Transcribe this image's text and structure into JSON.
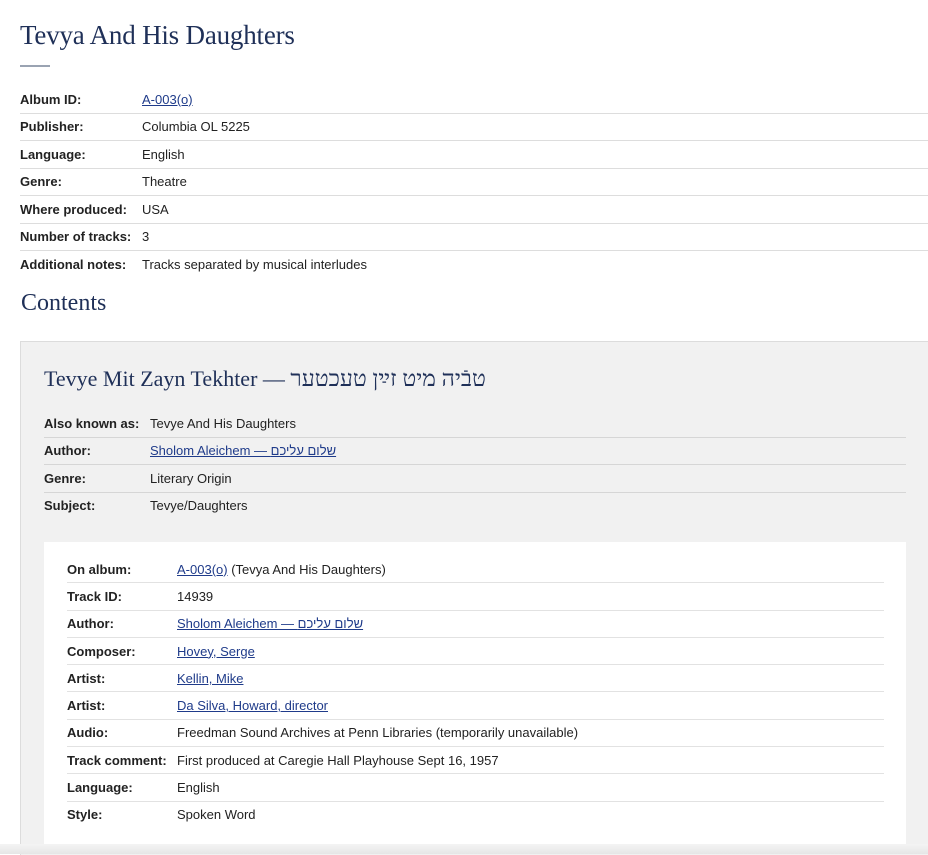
{
  "album": {
    "title": "Tevya And His Daughters",
    "fields": [
      {
        "label": "Album ID:",
        "value": "A-003(o)",
        "link": true
      },
      {
        "label": "Publisher:",
        "value": "Columbia OL 5225"
      },
      {
        "label": "Language:",
        "value": "English"
      },
      {
        "label": "Genre:",
        "value": "Theatre"
      },
      {
        "label": "Where produced:",
        "value": "USA"
      },
      {
        "label": "Number of tracks:",
        "value": "3"
      },
      {
        "label": "Additional notes:",
        "value": "Tracks separated by musical interludes"
      }
    ]
  },
  "contents": {
    "heading": "Contents",
    "work": {
      "title_latin": "Tevye Mit Zayn Tekhter",
      "title_sep": " — ",
      "title_hebrew": "טבֿיה מיט זײַן טעכטער",
      "fields": [
        {
          "label": "Also known as:",
          "value": "Tevye And His Daughters"
        },
        {
          "label": "Author:",
          "value": "Sholom Aleichem — שלום עליכם",
          "link": true
        },
        {
          "label": "Genre:",
          "value": "Literary Origin"
        },
        {
          "label": "Subject:",
          "value": "Tevye/Daughters"
        }
      ]
    },
    "track": {
      "on_album_label": "On album:",
      "on_album_link": "A-003(o)",
      "on_album_suffix": " (Tevya And His Daughters)",
      "fields": [
        {
          "label": "Track ID:",
          "value": "14939"
        },
        {
          "label": "Author:",
          "value": "Sholom Aleichem — שלום עליכם",
          "link": true
        },
        {
          "label": "Composer:",
          "value": "Hovey, Serge",
          "link": true
        },
        {
          "label": "Artist:",
          "value": "Kellin, Mike",
          "link": true
        },
        {
          "label": "Artist:",
          "value": "Da Silva, Howard, director",
          "link": true
        },
        {
          "label": "Audio:",
          "value": "Freedman Sound Archives at Penn Libraries (temporarily unavailable)"
        },
        {
          "label": "Track comment:",
          "value": "First produced at Caregie Hall Playhouse Sept 16, 1957"
        },
        {
          "label": "Language:",
          "value": "English"
        },
        {
          "label": "Style:",
          "value": "Spoken Word"
        }
      ]
    }
  },
  "colors": {
    "heading": "#1f3058",
    "link": "#1f3b8a",
    "panel_bg": "#f1f1f1"
  }
}
